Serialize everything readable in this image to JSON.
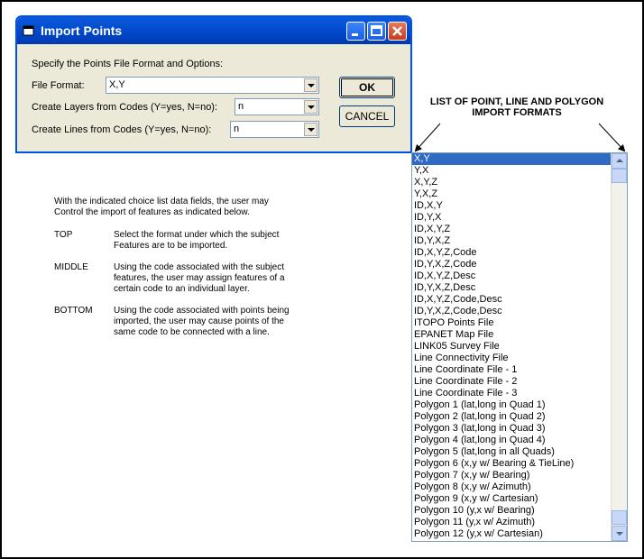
{
  "window": {
    "title": "Import Points",
    "prompt": "Specify the Points File Format and Options:",
    "fields": [
      {
        "label": "File Format:",
        "value": "X,Y"
      },
      {
        "label": "Create Layers from Codes (Y=yes, N=no):",
        "value": "n"
      },
      {
        "label": "Create Lines from Codes (Y=yes, N=no):",
        "value": "n"
      }
    ],
    "ok_label": "OK",
    "cancel_label": "CANCEL"
  },
  "annotation": {
    "line1": "LIST OF POINT, LINE AND POLYGON",
    "line2": "IMPORT FORMATS"
  },
  "description": {
    "intro1": "With the indicated choice list data fields, the user may",
    "intro2": "Control the import of features as indicated below.",
    "items": [
      {
        "term": "TOP",
        "lines": [
          "Select the format under which the subject",
          "Features are to be imported."
        ]
      },
      {
        "term": "MIDDLE",
        "lines": [
          "Using the code associated with the subject",
          "features, the user may assign features of a",
          "certain code to an individual layer."
        ]
      },
      {
        "term": "BOTTOM",
        "lines": [
          "Using the code associated with points being",
          "imported, the user may cause points of the",
          "same code to be connected with a line."
        ]
      }
    ]
  },
  "format_list": {
    "selected_index": 0,
    "items": [
      "X,Y",
      "Y,X",
      "X,Y,Z",
      "Y,X,Z",
      "ID,X,Y",
      "ID,Y,X",
      "ID,X,Y,Z",
      "ID,Y,X,Z",
      "ID,X,Y,Z,Code",
      "ID,Y,X,Z,Code",
      "ID,X,Y,Z,Desc",
      "ID,Y,X,Z,Desc",
      "ID,X,Y,Z,Code,Desc",
      "ID,Y,X,Z,Code,Desc",
      "ITOPO Points File",
      "EPANET Map File",
      "LINK05 Survey File",
      "Line Connectivity File",
      "Line Coordinate File - 1",
      "Line Coordinate File - 2",
      "Line Coordinate File - 3",
      "Polygon  1 (lat,long in Quad 1)",
      "Polygon  2 (lat,long in Quad 2)",
      "Polygon  3 (lat,long in Quad 3)",
      "Polygon  4 (lat,long in Quad 4)",
      "Polygon  5 (lat,long in all Quads)",
      "Polygon  6 (x,y w/ Bearing & TieLine)",
      "Polygon  7 (x,y w/ Bearing)",
      "Polygon  8 (x,y w/ Azimuth)",
      "Polygon  9 (x,y w/ Cartesian)",
      "Polygon 10 (y,x w/ Bearing)",
      "Polygon 11 (y,x w/ Azimuth)",
      "Polygon 12 (y,x w/ Cartesian)"
    ]
  }
}
